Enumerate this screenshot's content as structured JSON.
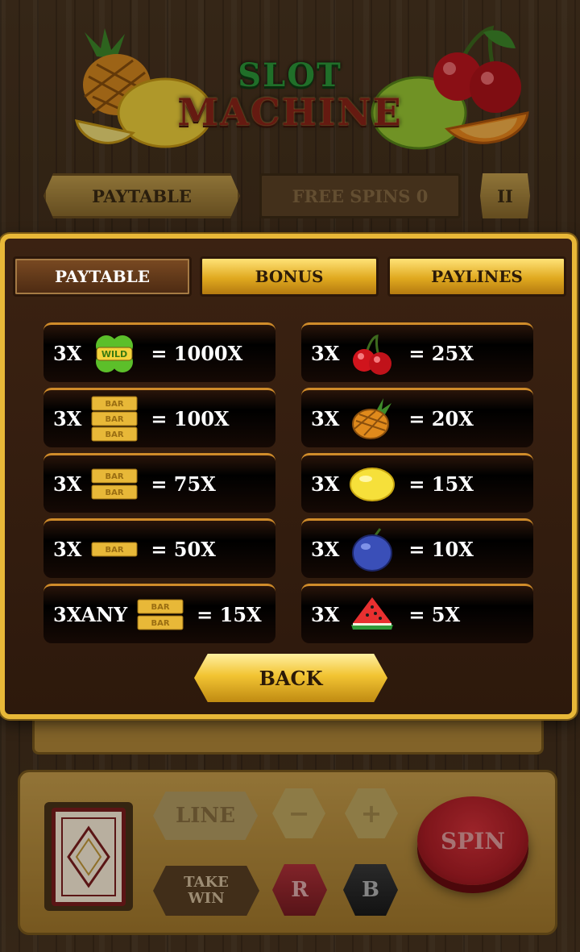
{
  "logo": {
    "line1": "SLOT",
    "line2": "MACHINE"
  },
  "top_bar": {
    "paytable_label": "PAYTABLE",
    "free_spins_label": "FREE SPINS 0",
    "pause_label": "II"
  },
  "tabs": {
    "paytable": "PAYTABLE",
    "bonus": "BONUS",
    "paylines": "PAYLINES"
  },
  "paytable": {
    "left": [
      {
        "mult": "3X",
        "icon": "wild-clover-icon",
        "payout": "= 1000X"
      },
      {
        "mult": "3X",
        "icon": "triple-bar-icon",
        "payout": "= 100X"
      },
      {
        "mult": "3X",
        "icon": "double-bar-icon",
        "payout": "= 75X"
      },
      {
        "mult": "3X",
        "icon": "single-bar-icon",
        "payout": "= 50X"
      },
      {
        "mult": "3XANY",
        "icon": "any-bar-icon",
        "payout": "= 15X"
      }
    ],
    "right": [
      {
        "mult": "3X",
        "icon": "cherry-icon",
        "payout": "= 25X"
      },
      {
        "mult": "3X",
        "icon": "pineapple-icon",
        "payout": "= 20X"
      },
      {
        "mult": "3X",
        "icon": "lemon-icon",
        "payout": "= 15X"
      },
      {
        "mult": "3X",
        "icon": "plum-icon",
        "payout": "= 10X"
      },
      {
        "mult": "3X",
        "icon": "watermelon-icon",
        "payout": "= 5X"
      }
    ],
    "wild_text": "WILD",
    "bar_text": "BAR"
  },
  "back_label": "BACK",
  "controls": {
    "line_label": "LINE",
    "minus_label": "−",
    "plus_label": "+",
    "take_win_line1": "TAKE",
    "take_win_line2": "WIN",
    "red_label": "R",
    "black_label": "B",
    "spin_label": "SPIN"
  },
  "colors": {
    "gold": "#e8b838",
    "panel": "#2d190c",
    "spin_red": "#b01e26"
  }
}
